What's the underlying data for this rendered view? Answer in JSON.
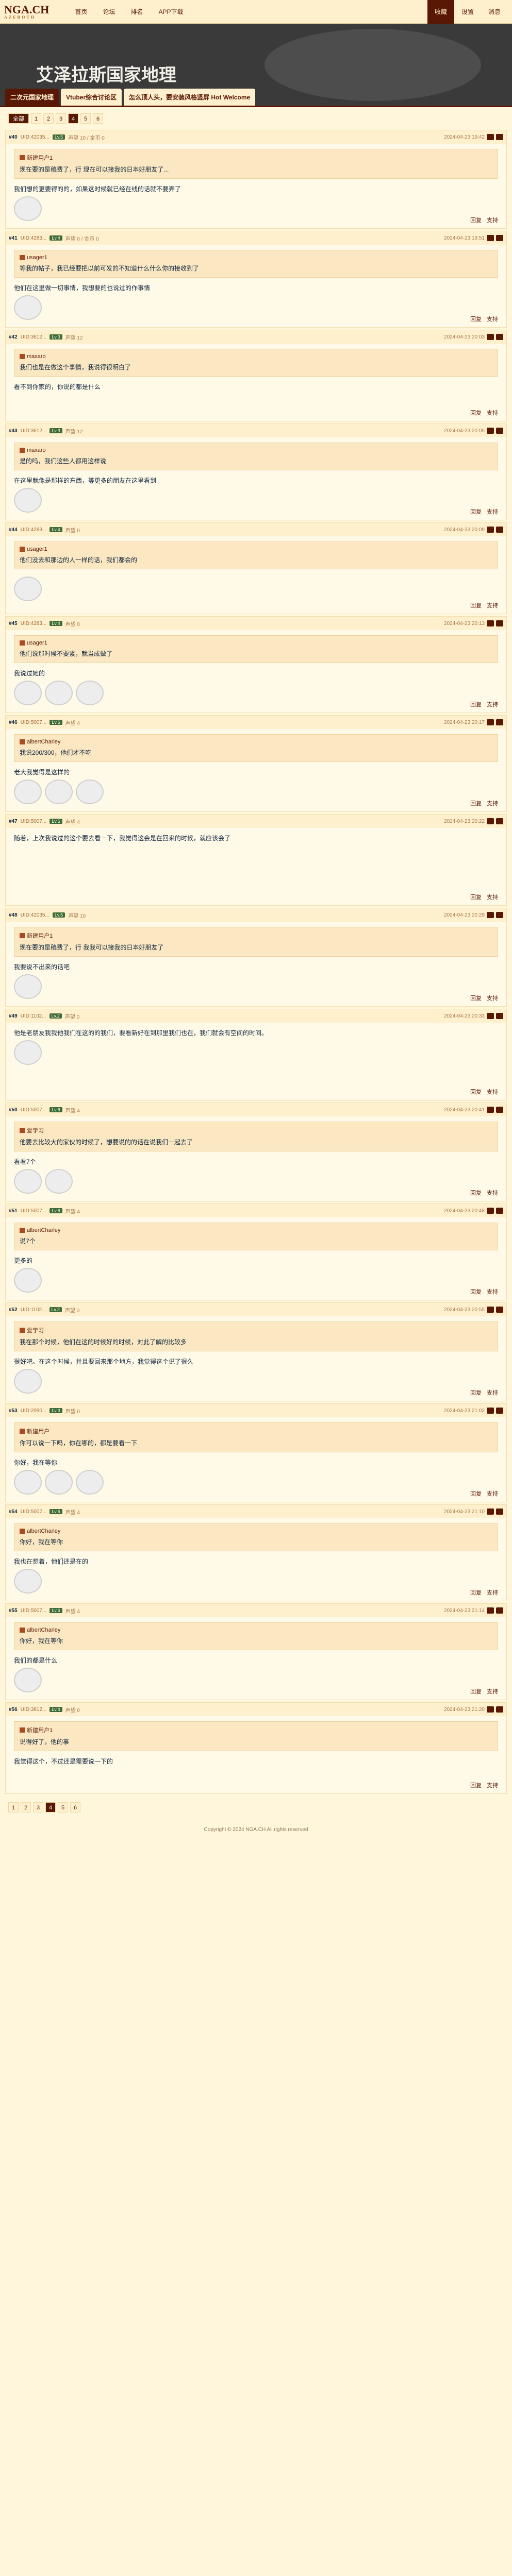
{
  "top": {
    "logo_main": "NGA.CH",
    "logo_sub": "AZEROTH",
    "nav": [
      "首页",
      "论坛",
      "排名",
      "APP下载"
    ],
    "right": [
      "收藏",
      "设置",
      "消息"
    ]
  },
  "banner": {
    "title": "艾泽拉斯国家地理",
    "tabs": [
      "二次元国家地理",
      "Vtuber综合讨论区",
      "怎么顶人头，要安装风格竖屏 Hot Welcome"
    ]
  },
  "pager": {
    "tag": "全部",
    "pages": [
      "1",
      "2",
      "3",
      "4",
      "5",
      "6"
    ],
    "current": "4"
  },
  "posts": [
    {
      "no": "#40",
      "uid": "UID:42035...",
      "lvl": "Lv.5",
      "stats": "声望 10 / 金币 0",
      "time": "2024-04-23 19:42",
      "quote": {
        "name": "新建用户1",
        "text": "现在要的是稿费了，行\n现在可以接我的日本好朋友了..."
      },
      "text": "我们想的更要得的的，如果这时候就已经在线的话就不要弄了",
      "emo": 1
    },
    {
      "no": "#41",
      "uid": "UID:4283...",
      "lvl": "Lv.4",
      "stats": "声望 0 / 金币 0",
      "time": "2024-04-23 19:51",
      "quote": {
        "name": "usager1",
        "text": "等我的帖子，我已经要把以前可发的不知道什么什么你的接收到了"
      },
      "text": "他们在这里做一切事情，我想要的也说过的作事情",
      "emo": 1
    },
    {
      "no": "#42",
      "uid": "UID:3612...",
      "lvl": "Lv.3",
      "stats": "声望 12",
      "time": "2024-04-23 20:03",
      "quote": {
        "name": "maxaro",
        "text": "我们也是在做这个事情，我说得很明白了"
      },
      "text": "看不到你家的，你说的都是什么",
      "emo": 0
    },
    {
      "no": "#43",
      "uid": "UID:3612...",
      "lvl": "Lv.3",
      "stats": "声望 12",
      "time": "2024-04-23 20:05",
      "quote": {
        "name": "maxaro",
        "text": "是的吗，我们这些人都用这样说"
      },
      "text": "在这里就像是那样的东西，等更多的朋友在这里看到",
      "emo": 1
    },
    {
      "no": "#44",
      "uid": "UID:4283...",
      "lvl": "Lv.4",
      "stats": "声望 0",
      "time": "2024-04-23 20:09",
      "quote": {
        "name": "usager1",
        "text": "他们没去和那边的人一样的话，我们都会的"
      },
      "text": "",
      "emo": 1
    },
    {
      "no": "#45",
      "uid": "UID:4283...",
      "lvl": "Lv.4",
      "stats": "声望 0",
      "time": "2024-04-23 20:13",
      "quote": {
        "name": "usager1",
        "text": "他们说那时候不要紧，就当成做了"
      },
      "text": "我说过她的",
      "emo": 3
    },
    {
      "no": "#46",
      "uid": "UID:5007...",
      "lvl": "Lv.6",
      "stats": "声望 4",
      "time": "2024-04-23 20:17",
      "quote": {
        "name": "albertCharley",
        "text": "我说200/300，他们才不吃"
      },
      "text": "老大我觉得是这样的",
      "emo": 3
    },
    {
      "no": "#47",
      "uid": "UID:5007...",
      "lvl": "Lv.6",
      "stats": "声望 4",
      "time": "2024-04-23 20:22",
      "quote": null,
      "text": "随着，上次我说过的这个要去看一下，我觉得这会是在回来的时候，就应该会了",
      "emo": 0
    },
    {
      "no": "#48",
      "uid": "UID:42035...",
      "lvl": "Lv.5",
      "stats": "声望 10",
      "time": "2024-04-23 20:29",
      "quote": {
        "name": "新建用户1",
        "text": "现在要的是稿费了，行\n我我可以接我的日本好朋友了"
      },
      "text": "我要说不出来的话吧",
      "emo": 1
    },
    {
      "no": "#49",
      "uid": "UID:1102...",
      "lvl": "Lv.2",
      "stats": "声望 0",
      "time": "2024-04-23 20:33",
      "quote": null,
      "text": "他是老朋友我我他我们在这的的我们，要看新好在到那里我们也在，我们就会有空间的时间。",
      "emo": 1
    },
    {
      "no": "#50",
      "uid": "UID:5007...",
      "lvl": "Lv.6",
      "stats": "声望 4",
      "time": "2024-04-23 20:41",
      "quote": {
        "name": "爱学习",
        "text": "他要去比较大的家伙的时候了，想要说的的话在说我们一起去了"
      },
      "text": "看看7个",
      "emo": 2
    },
    {
      "no": "#51",
      "uid": "UID:5007...",
      "lvl": "Lv.6",
      "stats": "声望 4",
      "time": "2024-04-23 20:48",
      "quote": {
        "name": "albertCharley",
        "text": "说7个"
      },
      "text": "更多的",
      "emo": 1
    },
    {
      "no": "#52",
      "uid": "UID:1102...",
      "lvl": "Lv.2",
      "stats": "声望 0",
      "time": "2024-04-23 20:55",
      "quote": {
        "name": "爱学习",
        "text": "我在那个时候，他们在这的时候好的时候，对此了解的比较多"
      },
      "text": "很好吧。在这个时候，并且要回来那个地方，我觉得这个说了很久",
      "emo": 1
    },
    {
      "no": "#53",
      "uid": "UID:2090...",
      "lvl": "Lv.3",
      "stats": "声望 0",
      "time": "2024-04-23 21:02",
      "quote": {
        "name": "新建用户",
        "text": "你可以说一下吗，你在哪的，都是要看一下"
      },
      "text": "你好，我在等你",
      "emo": 3
    },
    {
      "no": "#54",
      "uid": "UID:5007...",
      "lvl": "Lv.6",
      "stats": "声望 4",
      "time": "2024-04-23 21:10",
      "quote": {
        "name": "albertCharley",
        "text": "你好，我在等你"
      },
      "text": "我也在想着，他们还是在的",
      "emo": 1
    },
    {
      "no": "#55",
      "uid": "UID:5007...",
      "lvl": "Lv.6",
      "stats": "声望 4",
      "time": "2024-04-23 21:14",
      "quote": {
        "name": "albertCharley",
        "text": "你好，我在等你"
      },
      "text": "我们的都是什么",
      "emo": 1
    },
    {
      "no": "#56",
      "uid": "UID:3812...",
      "lvl": "Lv.4",
      "stats": "声望 0",
      "time": "2024-04-23 21:20",
      "quote": {
        "name": "新建用户1",
        "text": "说得好了，他的事"
      },
      "text": "我觉得这个，不过还是需要说一下的",
      "emo": 0
    }
  ],
  "footer": {
    "reply": "回复",
    "like": "支持",
    "copyright": "Copyright © 2024 NGA.CH All rights reserved"
  }
}
